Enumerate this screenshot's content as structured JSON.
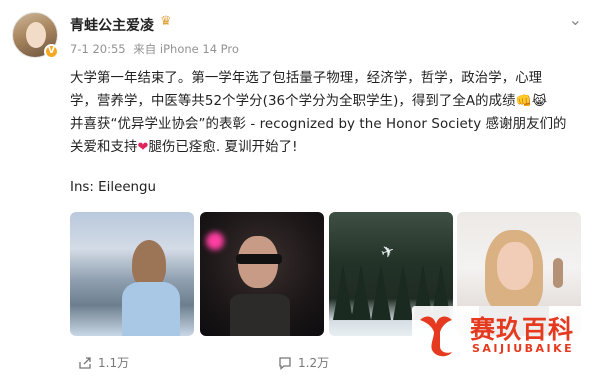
{
  "user": {
    "name": "青蛙公主爱凌",
    "verified_mark": "V"
  },
  "meta": {
    "time": "7-1 20:55",
    "source": "来自 iPhone 14 Pro"
  },
  "post": {
    "line1": "大学第一年结束了。第一学年选了包括量子物理，经济学，哲学，政治学，心理",
    "line2": "学，营养学，中医等共52个学分(36个学分为全职学生)，得到了全A的成绩",
    "line3": "并喜获“优异学业协会”的表彰 - recognized by the Honor Society 感谢朋友们的",
    "line4a": "关爱和支持",
    "line4b": "腿伤已痊愈. 夏训开始了!",
    "emoji_fist": "👊",
    "emoji_cat": "😹",
    "emoji_heart": "❤"
  },
  "credit": "Ins: Eileengu",
  "actions": {
    "share_count": "1.1万",
    "comment_count": "1.2万"
  },
  "watermark": {
    "cn": "赛玖百科",
    "en": "SAIJIUBAIKE"
  },
  "icons": {
    "more": "chevron-down-icon",
    "crown": "crown-badge-icon",
    "share": "share-icon",
    "comment": "comment-icon"
  },
  "colors": {
    "watermark": "#e63a20",
    "verified": "#f7a823",
    "meta_text": "#939393"
  }
}
